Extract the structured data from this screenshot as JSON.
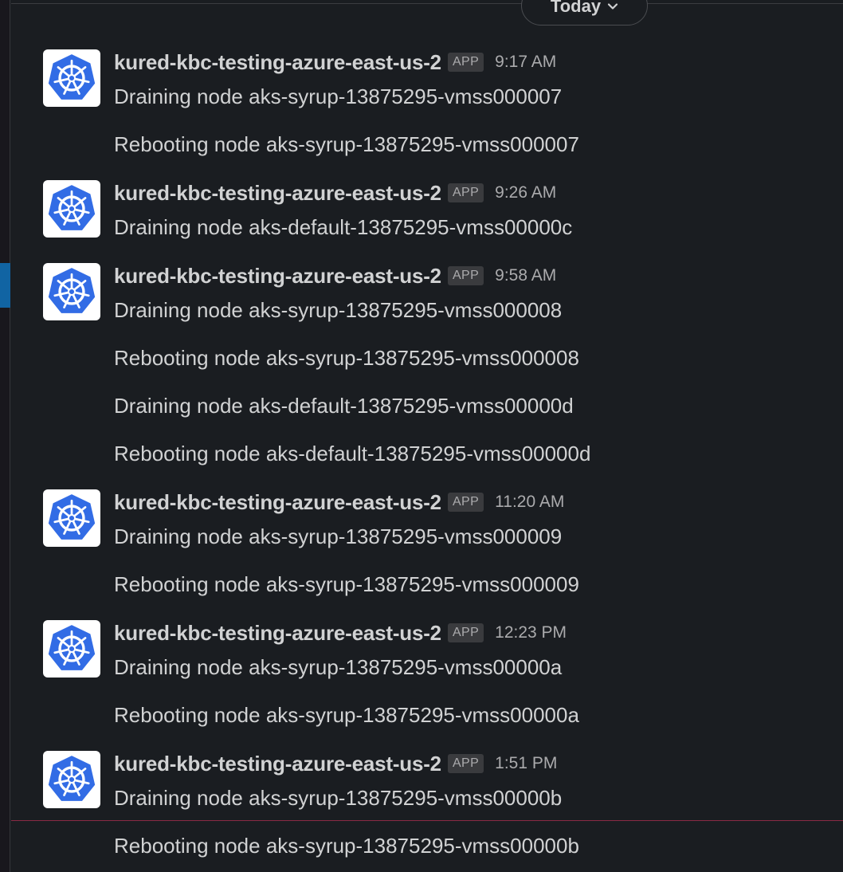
{
  "date_divider": {
    "label": "Today"
  },
  "colors": {
    "background": "#1a1d21",
    "text": "#d1d2d3",
    "muted": "#ababad",
    "avatar_blue": "#326ce5",
    "new_messages_line": "#8a2a45",
    "sidebar_active": "#1164a3"
  },
  "groups": [
    {
      "sender": "kured-kbc-testing-azure-east-us-2",
      "badge": "APP",
      "time": "9:17 AM",
      "avatar_icon": "kubernetes-icon",
      "lines": [
        "Draining node aks-syrup-13875295-vmss000007",
        "Rebooting node aks-syrup-13875295-vmss000007"
      ]
    },
    {
      "sender": "kured-kbc-testing-azure-east-us-2",
      "badge": "APP",
      "time": "9:26 AM",
      "avatar_icon": "kubernetes-icon",
      "lines": [
        "Draining node aks-default-13875295-vmss00000c"
      ]
    },
    {
      "sender": "kured-kbc-testing-azure-east-us-2",
      "badge": "APP",
      "time": "9:58 AM",
      "avatar_icon": "kubernetes-icon",
      "lines": [
        "Draining node aks-syrup-13875295-vmss000008",
        "Rebooting node aks-syrup-13875295-vmss000008",
        "Draining node aks-default-13875295-vmss00000d",
        "Rebooting node aks-default-13875295-vmss00000d"
      ]
    },
    {
      "sender": "kured-kbc-testing-azure-east-us-2",
      "badge": "APP",
      "time": "11:20 AM",
      "avatar_icon": "kubernetes-icon",
      "lines": [
        "Draining node aks-syrup-13875295-vmss000009",
        "Rebooting node aks-syrup-13875295-vmss000009"
      ]
    },
    {
      "sender": "kured-kbc-testing-azure-east-us-2",
      "badge": "APP",
      "time": "12:23 PM",
      "avatar_icon": "kubernetes-icon",
      "lines": [
        "Draining node aks-syrup-13875295-vmss00000a",
        "Rebooting node aks-syrup-13875295-vmss00000a"
      ]
    },
    {
      "sender": "kured-kbc-testing-azure-east-us-2",
      "badge": "APP",
      "time": "1:51 PM",
      "avatar_icon": "kubernetes-icon",
      "lines": [
        "Draining node aks-syrup-13875295-vmss00000b",
        "Rebooting node aks-syrup-13875295-vmss00000b"
      ]
    }
  ]
}
